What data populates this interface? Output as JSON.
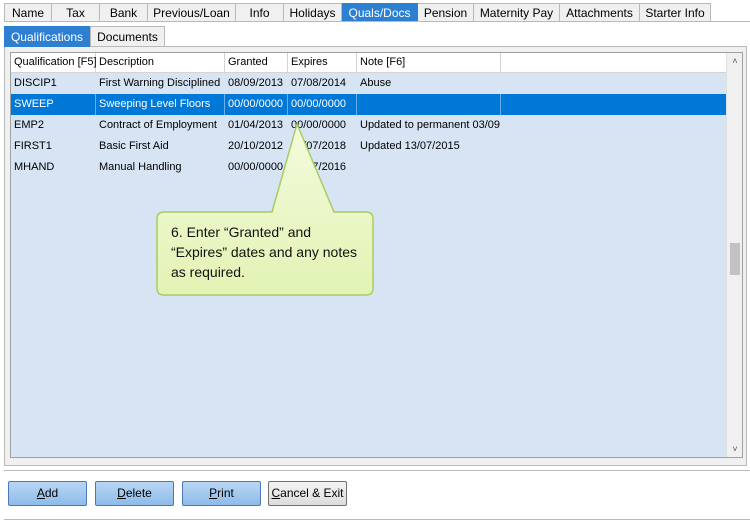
{
  "top_tabs": [
    "Name",
    "Tax",
    "Bank",
    "Previous/Loan",
    "Info",
    "Holidays",
    "Quals/Docs",
    "Pension",
    "Maternity Pay",
    "Attachments",
    "Starter Info"
  ],
  "active_top_tab": "Quals/Docs",
  "sub_tabs": [
    "Qualifications",
    "Documents"
  ],
  "grid": {
    "columns": [
      "Qualification [F5]",
      "Description",
      "Granted",
      "Expires",
      "Note [F6]",
      ""
    ],
    "rows": [
      {
        "code": "DISCIP1",
        "description": "First Warning Disciplined",
        "granted": "08/09/2013",
        "expires": "07/08/2014",
        "note": "Abuse",
        "extra": ""
      },
      {
        "code": "SWEEP",
        "description": "Sweeping Level Floors",
        "granted": "00/00/0000",
        "expires": "00/00/0000",
        "note": "",
        "extra": "",
        "selected": true
      },
      {
        "code": "EMP2",
        "description": "Contract of Employment",
        "granted": "01/04/2013",
        "expires": "00/00/0000",
        "note": "Updated to permanent 03/09,",
        "extra": ""
      },
      {
        "code": "FIRST1",
        "description": "Basic First Aid",
        "granted": "20/10/2012",
        "expires": "13/07/2018",
        "note": "Updated 13/07/2015",
        "extra": ""
      },
      {
        "code": "MHAND",
        "description": "Manual Handling",
        "granted": "00/00/0000",
        "expires": "17/07/2016",
        "note": "",
        "extra": ""
      }
    ]
  },
  "callout": {
    "text": "6. Enter “Granted” and “Expires” dates and any notes as required."
  },
  "buttons": {
    "add": {
      "mnemonic": "A",
      "rest": "dd"
    },
    "delete": {
      "mnemonic": "D",
      "rest": "elete"
    },
    "print": {
      "mnemonic": "P",
      "rest": "rint"
    },
    "cancel": {
      "mnemonic": "C",
      "rest": "ancel & Exit"
    }
  },
  "colors": {
    "accent": "#2d7fd1",
    "selection": "#0078d7",
    "grid_bg": "#d7e4f3",
    "callout_fill": "#eaf7c6",
    "callout_border": "#a9cc62"
  }
}
